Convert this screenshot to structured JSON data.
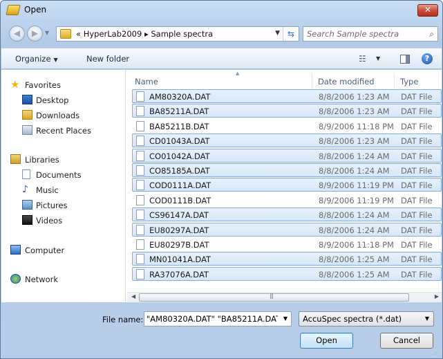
{
  "window": {
    "title": "Open",
    "close_label": "✕"
  },
  "address_bar": {
    "prefix": "«",
    "path": [
      "HyperLab2009",
      "Sample spectra"
    ],
    "separator": "▸"
  },
  "search": {
    "placeholder": "Search Sample spectra"
  },
  "toolbar": {
    "organize_label": "Organize",
    "new_folder_label": "New folder"
  },
  "navigation": {
    "favorites": {
      "label": "Favorites",
      "items": [
        "Desktop",
        "Downloads",
        "Recent Places"
      ]
    },
    "libraries": {
      "label": "Libraries",
      "items": [
        "Documents",
        "Music",
        "Pictures",
        "Videos"
      ]
    },
    "computer": {
      "label": "Computer"
    },
    "network": {
      "label": "Network"
    }
  },
  "file_list": {
    "columns": {
      "name": "Name",
      "date_modified": "Date modified",
      "type": "Type"
    },
    "rows": [
      {
        "name": "AM80320A.DAT",
        "date": "8/8/2006 1:23 AM",
        "type": "DAT File",
        "selected": true
      },
      {
        "name": "BA85211A.DAT",
        "date": "8/8/2006 1:23 AM",
        "type": "DAT File",
        "selected": true
      },
      {
        "name": "BA85211B.DAT",
        "date": "8/9/2006 11:18 PM",
        "type": "DAT File",
        "selected": false
      },
      {
        "name": "CD01043A.DAT",
        "date": "8/8/2006 1:23 AM",
        "type": "DAT File",
        "selected": true
      },
      {
        "name": "CO01042A.DAT",
        "date": "8/8/2006 1:24 AM",
        "type": "DAT File",
        "selected": true
      },
      {
        "name": "CO85185A.DAT",
        "date": "8/8/2006 1:24 AM",
        "type": "DAT File",
        "selected": true
      },
      {
        "name": "COD0111A.DAT",
        "date": "8/9/2006 11:19 PM",
        "type": "DAT File",
        "selected": true
      },
      {
        "name": "COD0111B.DAT",
        "date": "8/9/2006 11:19 PM",
        "type": "DAT File",
        "selected": false
      },
      {
        "name": "CS96147A.DAT",
        "date": "8/8/2006 1:24 AM",
        "type": "DAT File",
        "selected": true
      },
      {
        "name": "EU80297A.DAT",
        "date": "8/8/2006 1:24 AM",
        "type": "DAT File",
        "selected": true
      },
      {
        "name": "EU80297B.DAT",
        "date": "8/9/2006 11:18 PM",
        "type": "DAT File",
        "selected": false
      },
      {
        "name": "MN01041A.DAT",
        "date": "8/8/2006 1:25 AM",
        "type": "DAT File",
        "selected": true
      },
      {
        "name": "RA37076A.DAT",
        "date": "8/8/2006 1:25 AM",
        "type": "DAT File",
        "selected": true
      }
    ]
  },
  "bottom": {
    "file_name_label": "File name:",
    "file_name_value": "\"AM80320A.DAT\" \"BA85211A.DAT\"",
    "filter_value": "AccuSpec spectra (*.dat)",
    "open_label": "Open",
    "cancel_label": "Cancel"
  },
  "colors": {
    "selection_fill": "#dce9f9",
    "selection_border": "#84acdd",
    "accent": "#2f6fc0"
  }
}
